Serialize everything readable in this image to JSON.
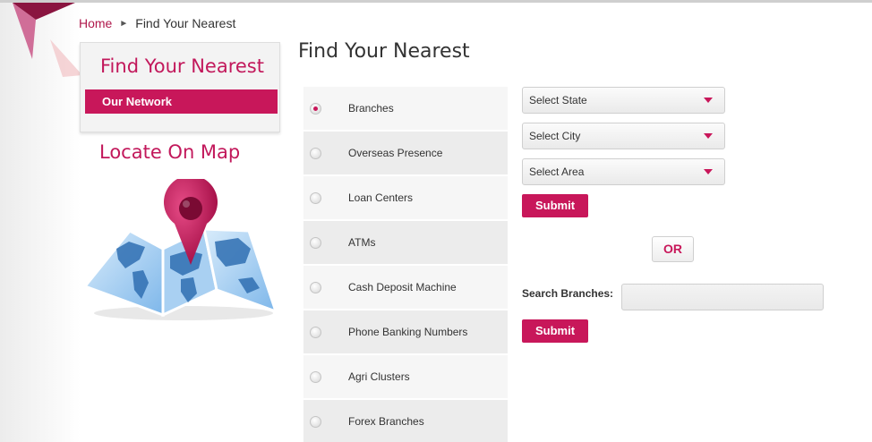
{
  "breadcrumb": {
    "home": "Home",
    "separator": "›",
    "current": "Find Your Nearest"
  },
  "sidebar": {
    "title": "Find Your Nearest",
    "items": [
      {
        "label": "Our Network"
      }
    ],
    "map_title": "Locate On Map"
  },
  "main": {
    "title": "Find Your Nearest",
    "options": [
      {
        "label": "Branches",
        "checked": true
      },
      {
        "label": "Overseas Presence",
        "checked": false
      },
      {
        "label": "Loan Centers",
        "checked": false
      },
      {
        "label": "ATMs",
        "checked": false
      },
      {
        "label": "Cash Deposit Machine",
        "checked": false
      },
      {
        "label": "Phone Banking Numbers",
        "checked": false
      },
      {
        "label": "Agri Clusters",
        "checked": false
      },
      {
        "label": "Forex Branches",
        "checked": false
      }
    ],
    "filters": {
      "state": "Select State",
      "city": "Select City",
      "area": "Select Area",
      "submit": "Submit"
    },
    "or_label": "OR",
    "search": {
      "label": "Search Branches:",
      "value": "",
      "submit": "Submit"
    }
  },
  "icons": {
    "breadcrumb_sep": "chevron-right-icon",
    "dropdown": "caret-down-icon",
    "map": "map-pin-icon"
  },
  "colors": {
    "accent": "#c8175a",
    "text": "#333333",
    "panel": "#f3f3f3"
  }
}
